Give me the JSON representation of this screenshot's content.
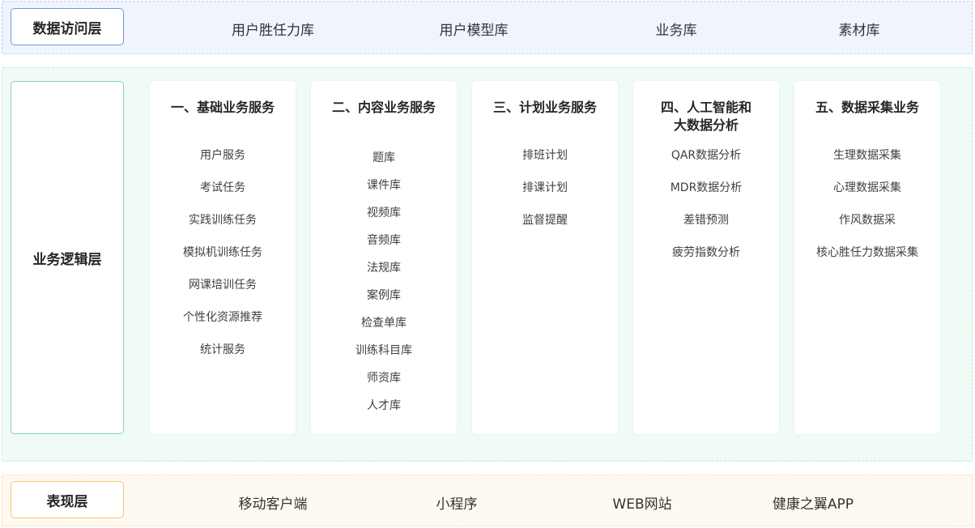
{
  "data_layer": {
    "label": "数据访问层",
    "items": [
      "用户胜任力库",
      "用户模型库",
      "业务库",
      "素材库"
    ]
  },
  "logic_layer": {
    "label": "业务逻辑层",
    "cards": [
      {
        "title": "一、基础业务服务",
        "items": [
          "用户服务",
          "考试任务",
          "实践训练任务",
          "模拟机训练任务",
          "网课培训任务",
          "个性化资源推荐",
          "统计服务"
        ]
      },
      {
        "title": "二、内容业务服务",
        "items": [
          "题库",
          "课件库",
          "视频库",
          "音频库",
          "法规库",
          "案例库",
          "检查单库",
          "训练科目库",
          "师资库",
          "人才库"
        ]
      },
      {
        "title": "三、计划业务服务",
        "items": [
          "排班计划",
          "排课计划",
          "监督提醒"
        ]
      },
      {
        "title": "四、人工智能和\n大数据分析",
        "items": [
          "QAR数据分析",
          "MDR数据分析",
          "差错预测",
          "疲劳指数分析"
        ]
      },
      {
        "title": "五、数据采集业务",
        "items": [
          "生理数据采集",
          "心理数据采集",
          "作风数据采",
          "核心胜任力数据采集"
        ]
      }
    ]
  },
  "presentation_layer": {
    "label": "表现层",
    "items": [
      "移动客户端",
      "小程序",
      "WEB网站",
      "健康之翼APP"
    ]
  }
}
